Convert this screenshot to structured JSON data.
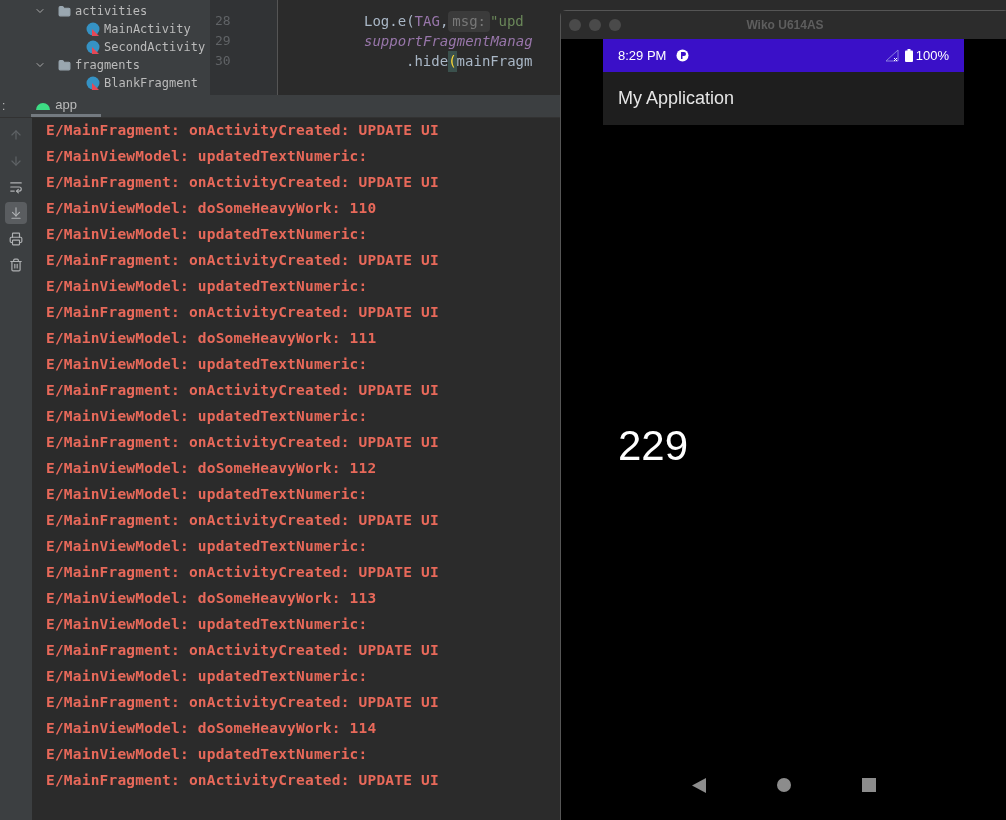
{
  "project_tree": [
    {
      "label": "activities",
      "kind": "folder",
      "expanded": true,
      "children": [
        {
          "label": "MainActivity",
          "kind": "class"
        },
        {
          "label": "SecondActivity",
          "kind": "class"
        }
      ]
    },
    {
      "label": "fragments",
      "kind": "folder",
      "expanded": true,
      "children": [
        {
          "label": "BlankFragment",
          "kind": "class"
        }
      ]
    }
  ],
  "code_lines": [
    {
      "number": "28",
      "continuation": false,
      "segments": [
        {
          "kind": "plain",
          "text": "Log.e("
        },
        {
          "kind": "constant",
          "text": "TAG"
        },
        {
          "kind": "plain",
          "text": ", "
        },
        {
          "kind": "hint",
          "text": "msg:"
        },
        {
          "kind": "string",
          "text": " \"upd"
        }
      ]
    },
    {
      "number": "29",
      "continuation": false,
      "segments": [
        {
          "kind": "call",
          "text": "supportFragmentManag"
        }
      ]
    },
    {
      "number": "30",
      "continuation": true,
      "segments": [
        {
          "kind": "plain",
          "text": ".hide"
        },
        {
          "kind": "brace",
          "text": "("
        },
        {
          "kind": "plain",
          "text": "mainFragm"
        }
      ]
    }
  ],
  "run_tab": {
    "prefix": ":",
    "label": "app"
  },
  "log_toolbar": [
    {
      "kind": "up",
      "disabled": true,
      "selected": false
    },
    {
      "kind": "down",
      "disabled": true,
      "selected": false
    },
    {
      "kind": "wrap",
      "disabled": false,
      "selected": false
    },
    {
      "kind": "scroll_end",
      "disabled": false,
      "selected": true
    },
    {
      "kind": "print",
      "disabled": false,
      "selected": false
    },
    {
      "kind": "trash",
      "disabled": false,
      "selected": false
    }
  ],
  "log_lines": [
    "E/MainFragment: onActivityCreated: UPDATE UI",
    "E/MainViewModel: updatedTextNumeric:",
    "E/MainFragment: onActivityCreated: UPDATE UI",
    "E/MainViewModel: doSomeHeavyWork: 110",
    "E/MainViewModel: updatedTextNumeric:",
    "E/MainFragment: onActivityCreated: UPDATE UI",
    "E/MainViewModel: updatedTextNumeric:",
    "E/MainFragment: onActivityCreated: UPDATE UI",
    "E/MainViewModel: doSomeHeavyWork: 111",
    "E/MainViewModel: updatedTextNumeric:",
    "E/MainFragment: onActivityCreated: UPDATE UI",
    "E/MainViewModel: updatedTextNumeric:",
    "E/MainFragment: onActivityCreated: UPDATE UI",
    "E/MainViewModel: doSomeHeavyWork: 112",
    "E/MainViewModel: updatedTextNumeric:",
    "E/MainFragment: onActivityCreated: UPDATE UI",
    "E/MainViewModel: updatedTextNumeric:",
    "E/MainFragment: onActivityCreated: UPDATE UI",
    "E/MainViewModel: doSomeHeavyWork: 113",
    "E/MainViewModel: updatedTextNumeric:",
    "E/MainFragment: onActivityCreated: UPDATE UI",
    "E/MainViewModel: updatedTextNumeric:",
    "E/MainFragment: onActivityCreated: UPDATE UI",
    "E/MainViewModel: doSomeHeavyWork: 114",
    "E/MainViewModel: updatedTextNumeric:",
    "E/MainFragment: onActivityCreated: UPDATE UI"
  ],
  "emulator": {
    "title": "Wiko U614AS",
    "status_bar": {
      "time": "8:29 PM",
      "battery": "100%"
    },
    "app_bar": {
      "title": "My Application"
    },
    "counter": "229"
  }
}
